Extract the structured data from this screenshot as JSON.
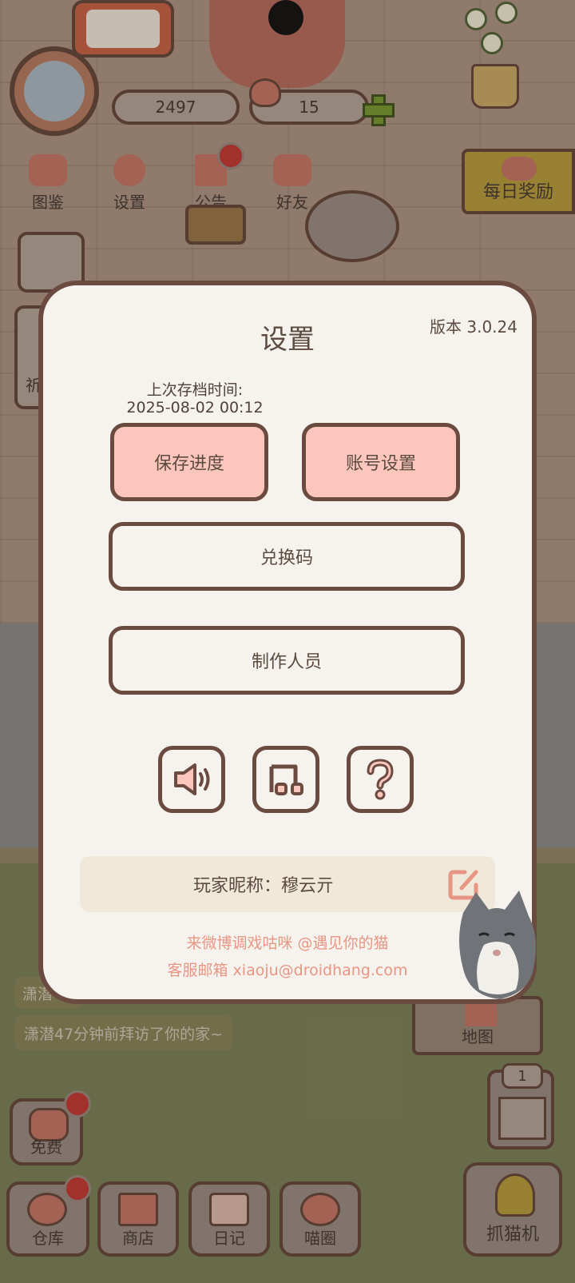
{
  "hud": {
    "coins": "2497",
    "hearts": "15"
  },
  "top_menu": [
    {
      "label": "图鉴",
      "icon": "cat-head-icon"
    },
    {
      "label": "设置",
      "icon": "gear-icon"
    },
    {
      "label": "公告",
      "icon": "gift-icon"
    },
    {
      "label": "好友",
      "icon": "friends-icon"
    }
  ],
  "daily_reward": {
    "label": "每日奖励"
  },
  "side_card_char": "祈",
  "settings": {
    "title": "设置",
    "version": "版本 3.0.24",
    "last_save_label": "上次存档时间:",
    "last_save_time": "2025-08-02 00:12",
    "save_button": "保存进度",
    "account_button": "账号设置",
    "redeem_button": "兑换码",
    "credits_button": "制作人员",
    "icons": [
      "speaker-icon",
      "music-note-icon",
      "question-icon"
    ],
    "nickname_label": "玩家昵称：穆云亓",
    "weibo_text": "来微博调戏咕咪 @遇见你的猫",
    "email_text": "客服邮箱 xiaoju@droidhang.com"
  },
  "feed": {
    "short_msg": "潇潜",
    "visit_msg": "潇潜47分钟前拜访了你的家~"
  },
  "map": {
    "label": "地图"
  },
  "elevator": {
    "floor": "1"
  },
  "bottom_bar": {
    "free": "免费",
    "storage": "仓库",
    "shop": "商店",
    "diary": "日记",
    "circle": "喵圈",
    "claw": "抓猫机"
  },
  "colors": {
    "modal_bg": "#f6f3ee",
    "modal_border": "#6b4a40",
    "pink_button": "#fdc6bc",
    "footer_text": "#e89683",
    "badge_red": "#b1322d"
  }
}
